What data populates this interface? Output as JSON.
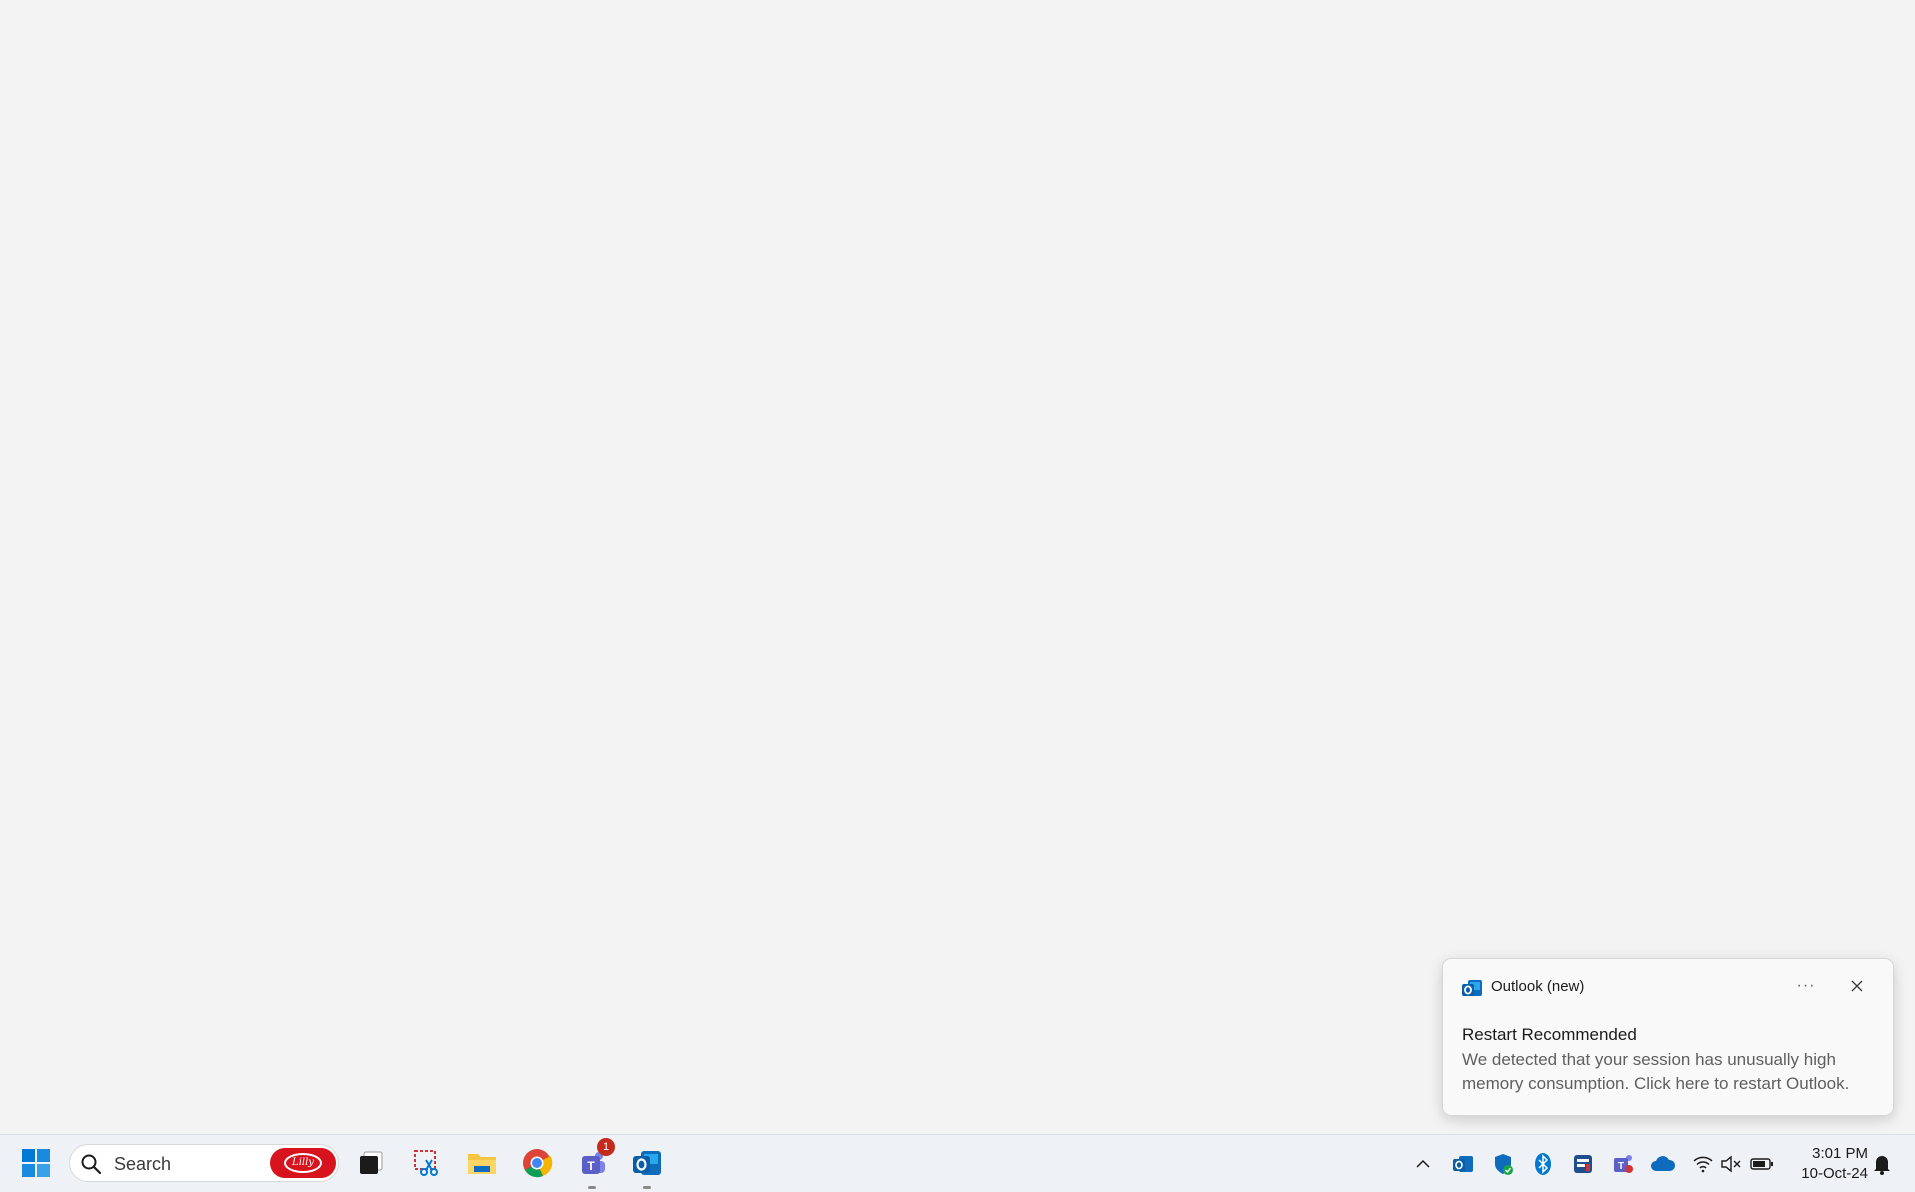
{
  "toast": {
    "app_name": "Outlook (new)",
    "more_label": "···",
    "title": "Restart Recommended",
    "body": "We detected that your session has unusually high memory consumption. Click here to restart Outlook."
  },
  "taskbar": {
    "search_placeholder": "Search",
    "search_badge_text": "Lilly",
    "apps": [
      {
        "name": "start",
        "icon": "windows-logo-icon"
      },
      {
        "name": "task-view",
        "icon": "task-view-icon"
      },
      {
        "name": "snipping-tool",
        "icon": "snipping-tool-icon"
      },
      {
        "name": "file-explorer",
        "icon": "folder-icon"
      },
      {
        "name": "chrome",
        "icon": "chrome-icon"
      },
      {
        "name": "teams",
        "icon": "teams-icon",
        "badge": "1",
        "running": true
      },
      {
        "name": "outlook",
        "icon": "outlook-icon",
        "running": true
      }
    ],
    "tray": [
      "chevron-up-icon",
      "outlook-tray-icon",
      "defender-icon",
      "bluetooth-icon",
      "app-tray-icon",
      "teams-tray-icon",
      "onedrive-icon",
      "wifi-icon",
      "volume-muted-icon",
      "battery-icon"
    ],
    "clock": {
      "time": "3:01 PM",
      "date": "10-Oct-24"
    }
  },
  "colors": {
    "desktop_bg": "#f3f3f3",
    "taskbar_bg": "#eef1f5",
    "accent_blue": "#0078d4",
    "badge_red": "#c42b1c"
  }
}
